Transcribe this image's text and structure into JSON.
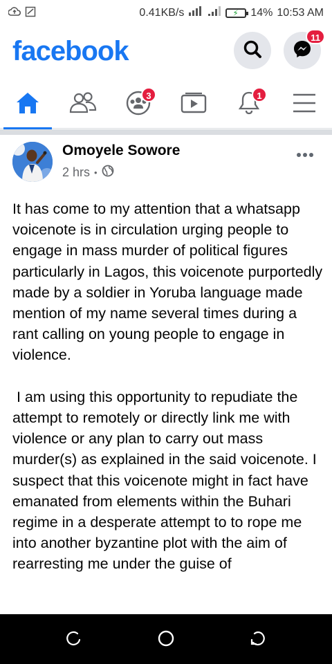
{
  "status_bar": {
    "speed": "0.41KB/s",
    "battery": "14%",
    "time": "10:53 AM"
  },
  "header": {
    "logo": "facebook",
    "messenger_badge": "11"
  },
  "tabs": [
    {
      "name": "home",
      "badge": ""
    },
    {
      "name": "friends",
      "badge": ""
    },
    {
      "name": "groups",
      "badge": "3"
    },
    {
      "name": "watch",
      "badge": ""
    },
    {
      "name": "notifications",
      "badge": "1"
    },
    {
      "name": "menu",
      "badge": ""
    }
  ],
  "post": {
    "author": "Omoyele Sowore",
    "time": "2 hrs",
    "separator": "•",
    "text": "It has come to my attention that a whatsapp voicenote is in circulation urging people to engage in mass murder of political figures particularly in Lagos, this voicenote purportedly made by a soldier in Yoruba language made mention of my name several times during a rant calling on young people to engage in violence.\n\n I am using this opportunity to repudiate the attempt to remotely or directly link me with violence or any plan to carry out mass murder(s) as explained in the said voicenote. I suspect that this voicenote might in fact have emanated from elements within the Buhari regime in a desperate attempt to to rope me into another byzantine plot with the aim of rearresting me under the guise of"
  },
  "colors": {
    "brand": "#1877f2",
    "badge": "#e41e3f",
    "muted": "#65676b"
  }
}
